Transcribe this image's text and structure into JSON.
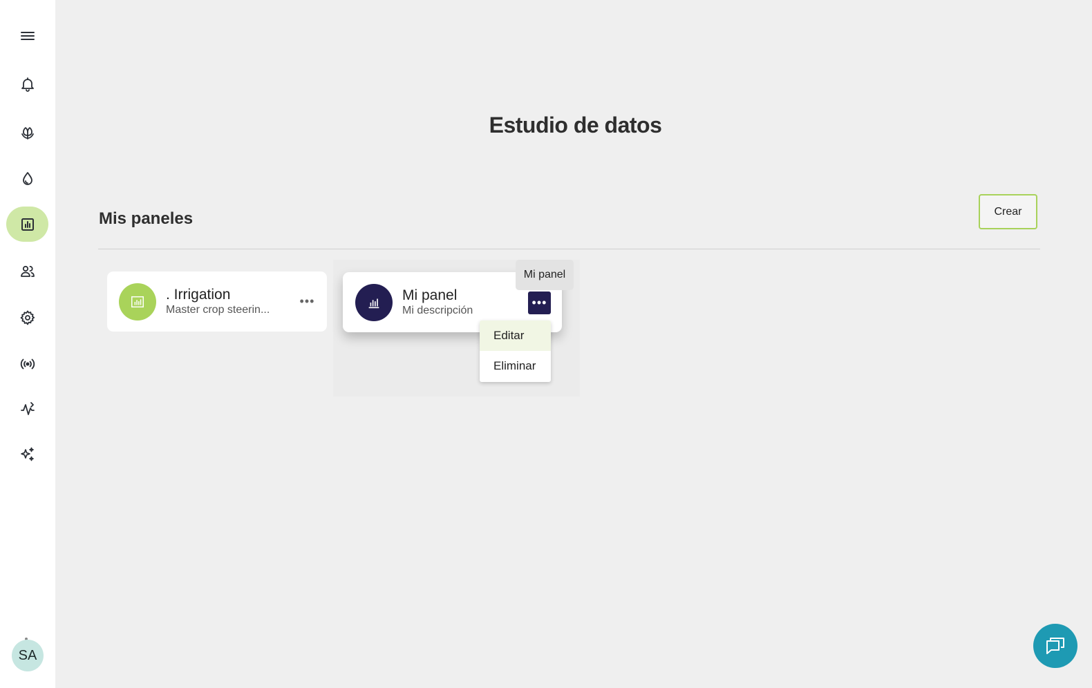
{
  "page": {
    "title": "Estudio de datos"
  },
  "section": {
    "title": "Mis paneles",
    "create_label": "Crear"
  },
  "sidebar": {
    "items": [
      {
        "icon": "menu-icon"
      },
      {
        "icon": "bell-icon"
      },
      {
        "icon": "plant-icon"
      },
      {
        "icon": "water-drop-icon"
      },
      {
        "icon": "chart-icon",
        "active": true
      },
      {
        "icon": "users-icon"
      },
      {
        "icon": "gear-icon"
      },
      {
        "icon": "signal-icon"
      },
      {
        "icon": "analytics-icon"
      },
      {
        "icon": "sparkles-icon"
      }
    ],
    "avatar": "SA"
  },
  "panels": [
    {
      "title": ". Irrigation",
      "description": "Master crop steerin...",
      "icon_color": "#a9d35a"
    },
    {
      "title": "Mi panel",
      "description": "Mi descripción",
      "icon_color": "#231e52"
    }
  ],
  "tooltip": "Mi panel",
  "menu": {
    "items": [
      "Editar",
      "Eliminar"
    ]
  },
  "colors": {
    "accent": "#a9d35a",
    "active_nav": "#cfe8a6",
    "panel_dark": "#231e52",
    "chat": "#1e9ab3"
  }
}
